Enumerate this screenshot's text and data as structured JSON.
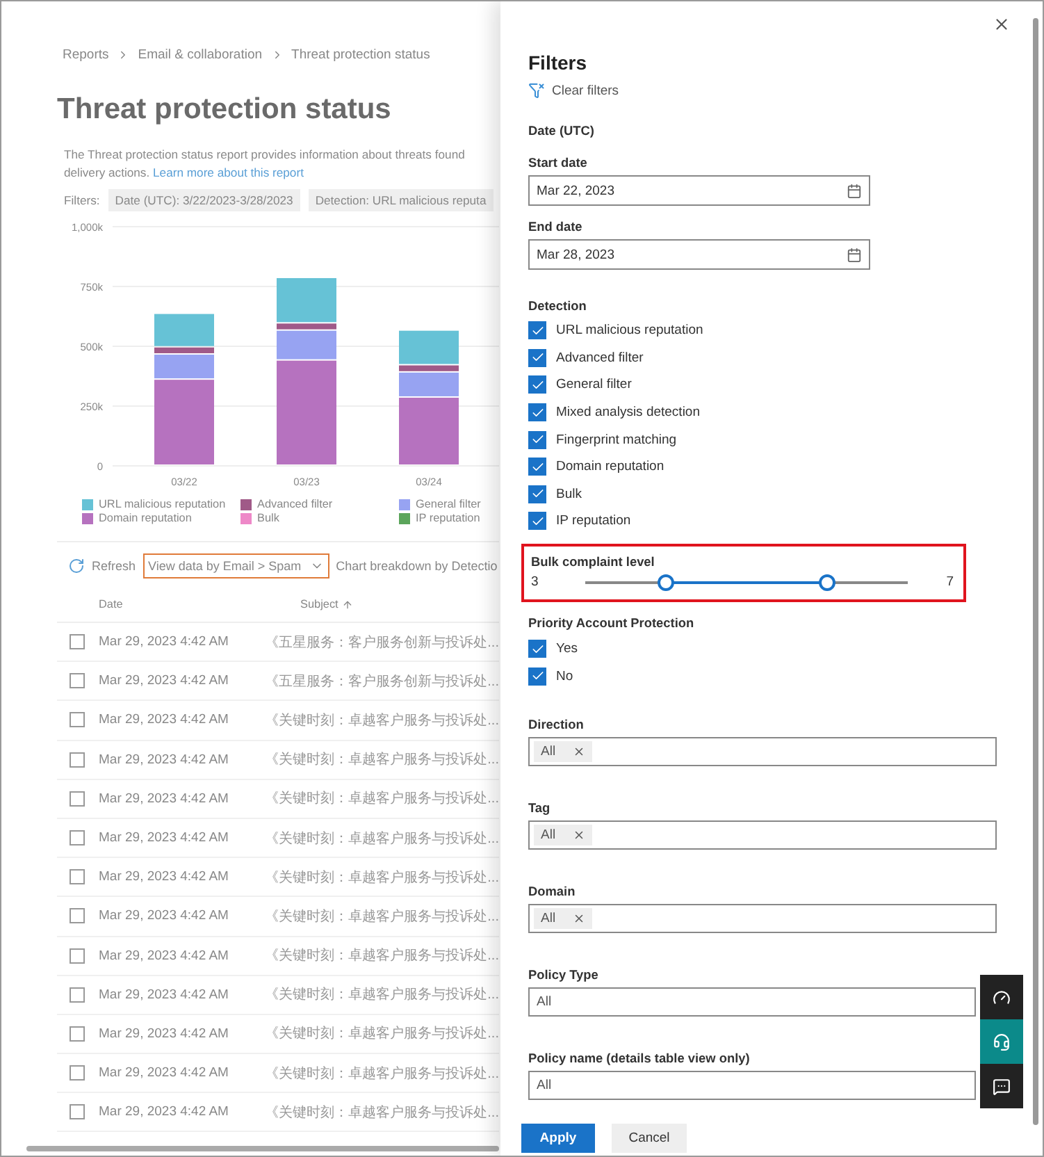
{
  "breadcrumb": [
    "Reports",
    "Email & collaboration",
    "Threat protection status"
  ],
  "title": "Threat protection status",
  "description": {
    "text": "The Threat protection status report provides information about threats found",
    "text_2": "delivery actions.",
    "link": "Learn more about this report"
  },
  "filters": {
    "label": "Filters:",
    "chips": [
      "Date (UTC): 3/22/2023-3/28/2023",
      "Detection: URL malicious reputa"
    ]
  },
  "chart": {
    "chart_data": {
      "type": "bar",
      "stacked": true,
      "grid": true,
      "categories": [
        "03/22",
        "03/23",
        "03/24"
      ],
      "ylim": [
        0,
        1000
      ],
      "yticks": [
        {
          "value": 0,
          "label": "0"
        },
        {
          "value": 250,
          "label": "250k"
        },
        {
          "value": 500,
          "label": "500k"
        },
        {
          "value": 750,
          "label": "750k"
        },
        {
          "value": 1000,
          "label": "1,000k"
        }
      ],
      "series": [
        {
          "name": "URL malicious reputation",
          "color": "#66c2d6",
          "values": [
            140,
            190,
            145
          ]
        },
        {
          "name": "Advanced filter",
          "color": "#a05a88",
          "values": [
            30,
            30,
            30
          ]
        },
        {
          "name": "General filter",
          "color": "#97a3f2",
          "values": [
            105,
            125,
            105
          ]
        },
        {
          "name": "Domain reputation",
          "color": "#b672bf",
          "values": [
            360,
            440,
            285
          ]
        },
        {
          "name": "Bulk",
          "color": "#ee88c8",
          "values": [
            0,
            0,
            0
          ]
        },
        {
          "name": "IP reputation",
          "color": "#5ba55b",
          "values": [
            0,
            0,
            0
          ]
        }
      ]
    }
  },
  "toolbar": {
    "refresh": "Refresh",
    "view_dropdown": {
      "label": "View data by Email > Spam",
      "highlighted": true
    },
    "breakdown": "Chart breakdown by Detectio"
  },
  "table": {
    "columns": [
      "Date",
      "Subject"
    ],
    "rows": [
      {
        "date": "Mar 29, 2023 4:42 AM",
        "subject": "《五星服务：客户服务创新与投诉处...",
        "checked": false
      },
      {
        "date": "Mar 29, 2023 4:42 AM",
        "subject": "《五星服务：客户服务创新与投诉处...",
        "checked": false
      },
      {
        "date": "Mar 29, 2023 4:42 AM",
        "subject": "《关键时刻：卓越客户服务与投诉处...",
        "checked": false
      },
      {
        "date": "Mar 29, 2023 4:42 AM",
        "subject": "《关键时刻：卓越客户服务与投诉处...",
        "checked": false
      },
      {
        "date": "Mar 29, 2023 4:42 AM",
        "subject": "《关键时刻：卓越客户服务与投诉处...",
        "checked": false
      },
      {
        "date": "Mar 29, 2023 4:42 AM",
        "subject": "《关键时刻：卓越客户服务与投诉处...",
        "checked": false
      },
      {
        "date": "Mar 29, 2023 4:42 AM",
        "subject": "《关键时刻：卓越客户服务与投诉处...",
        "checked": false
      },
      {
        "date": "Mar 29, 2023 4:42 AM",
        "subject": "《关键时刻：卓越客户服务与投诉处...",
        "checked": false
      },
      {
        "date": "Mar 29, 2023 4:42 AM",
        "subject": "《关键时刻：卓越客户服务与投诉处...",
        "checked": false
      },
      {
        "date": "Mar 29, 2023 4:42 AM",
        "subject": "《关键时刻：卓越客户服务与投诉处...",
        "checked": false
      },
      {
        "date": "Mar 29, 2023 4:42 AM",
        "subject": "《关键时刻：卓越客户服务与投诉处...",
        "checked": false
      },
      {
        "date": "Mar 29, 2023 4:42 AM",
        "subject": "《关键时刻：卓越客户服务与投诉处...",
        "checked": false
      },
      {
        "date": "Mar 29, 2023 4:42 AM",
        "subject": "《关键时刻：卓越客户服务与投诉处...",
        "checked": false
      }
    ]
  },
  "panel": {
    "title": "Filters",
    "clear_filters": "Clear filters",
    "date_heading": "Date (UTC)",
    "start_date": {
      "label": "Start date",
      "value": "Mar 22, 2023"
    },
    "end_date": {
      "label": "End date",
      "value": "Mar 28, 2023"
    },
    "detection": {
      "label": "Detection",
      "options": [
        {
          "label": "URL malicious reputation",
          "checked": true
        },
        {
          "label": "Advanced filter",
          "checked": true
        },
        {
          "label": "General filter",
          "checked": true
        },
        {
          "label": "Mixed analysis detection",
          "checked": true
        },
        {
          "label": "Fingerprint matching",
          "checked": true
        },
        {
          "label": "Domain reputation",
          "checked": true
        },
        {
          "label": "Bulk",
          "checked": true
        },
        {
          "label": "IP reputation",
          "checked": true
        }
      ]
    },
    "bulk_complaint": {
      "label": "Bulk complaint level",
      "min": "3",
      "max": "7",
      "highlighted": true,
      "thumbs": [
        {
          "level": 0.25
        },
        {
          "level": 0.75
        }
      ]
    },
    "priority": {
      "label": "Priority Account Protection",
      "options": [
        {
          "label": "Yes",
          "checked": true
        },
        {
          "label": "No",
          "checked": true
        }
      ]
    },
    "selects": [
      {
        "label": "Direction",
        "kind": "tags",
        "tags": [
          "All"
        ]
      },
      {
        "label": "Tag",
        "kind": "tags",
        "tags": [
          "All"
        ]
      },
      {
        "label": "Domain",
        "kind": "tags",
        "tags": [
          "All"
        ]
      },
      {
        "label": "Policy Type",
        "kind": "dropdown",
        "value": "All"
      },
      {
        "label": "Policy name (details table view only)",
        "kind": "dropdown",
        "value": "All"
      }
    ],
    "apply": "Apply",
    "cancel": "Cancel"
  }
}
